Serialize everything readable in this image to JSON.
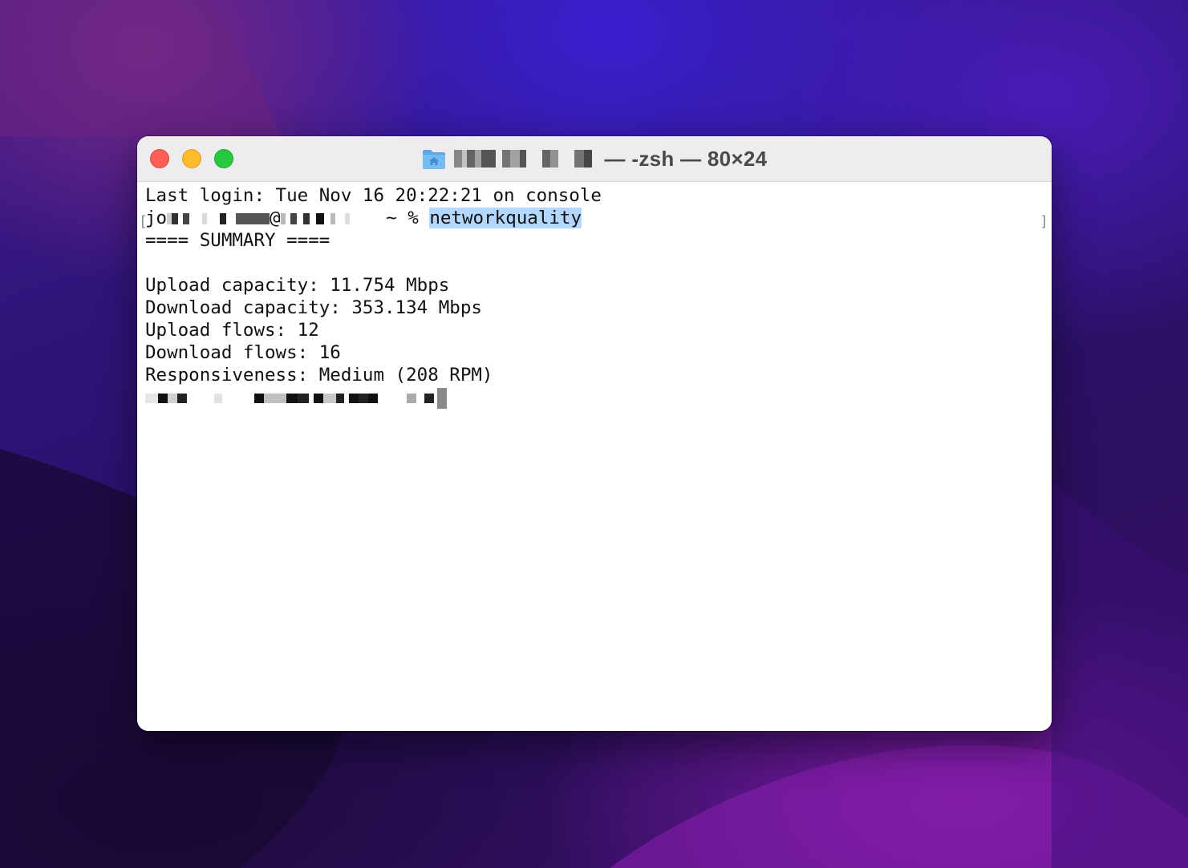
{
  "window": {
    "title": "— -zsh — 80×24",
    "title_icon": "home-folder-icon",
    "traffic_lights": {
      "close_color": "#fe5f57",
      "minimize_color": "#febc2e",
      "zoom_color": "#28c840"
    }
  },
  "terminal": {
    "last_login": "Last login: Tue Nov 16 20:22:21 on console",
    "prompt_user_prefix": "jo",
    "prompt_at": "@",
    "prompt_symbol": " ~ % ",
    "command": "networkquality",
    "summary_header": "==== SUMMARY ====",
    "upload_capacity": "Upload capacity: 11.754 Mbps",
    "download_capacity": "Download capacity: 353.134 Mbps",
    "upload_flows": "Upload flows: 12",
    "download_flows": "Download flows: 16",
    "responsiveness": "Responsiveness: Medium (208 RPM)",
    "left_marker": "[",
    "right_marker": "]",
    "highlight_color": "#b3d7ff"
  }
}
